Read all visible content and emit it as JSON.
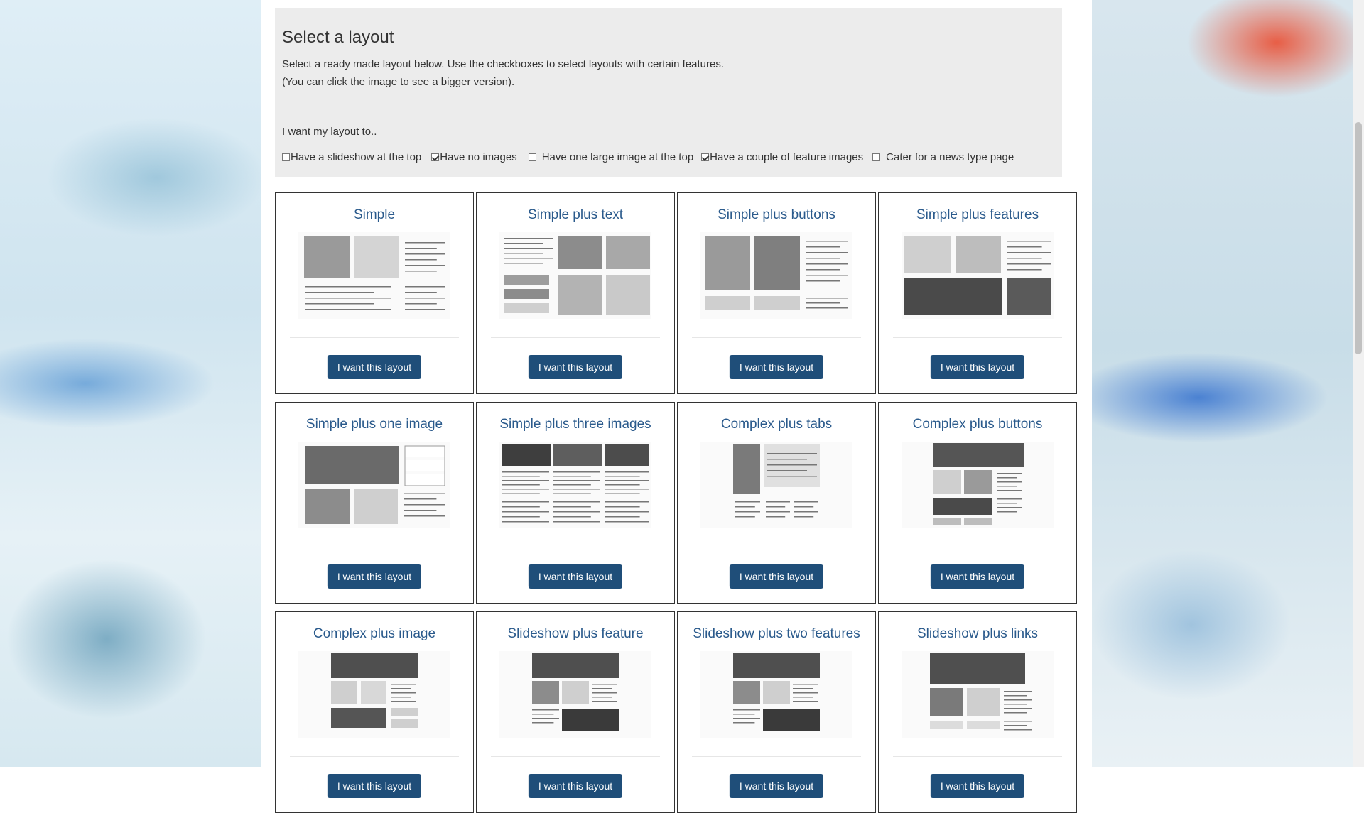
{
  "intro": {
    "title": "Select a layout",
    "line1": "Select a ready made layout below. Use the checkboxes to select layouts with certain features.",
    "line2": "(You can click the image to see a bigger version).",
    "prompt": "I want my layout to.."
  },
  "filters": [
    {
      "label": "Have a slideshow at the top",
      "checked": false
    },
    {
      "label": "Have no images",
      "checked": true
    },
    {
      "label": "Have one large image at the top",
      "checked": false
    },
    {
      "label": "Have a couple of feature images",
      "checked": true
    },
    {
      "label": "Cater for a news type page",
      "checked": false
    }
  ],
  "layouts": [
    {
      "title": "Simple",
      "button": "I want this layout",
      "thumb": "text"
    },
    {
      "title": "Simple plus text",
      "button": "I want this layout",
      "thumb": "text-buttons"
    },
    {
      "title": "Simple plus buttons",
      "button": "I want this layout",
      "thumb": "buttons"
    },
    {
      "title": "Simple plus features",
      "button": "I want this layout",
      "thumb": "features"
    },
    {
      "title": "Simple plus one image",
      "button": "I want this layout",
      "thumb": "one-image"
    },
    {
      "title": "Simple plus three images",
      "button": "I want this layout",
      "thumb": "three-images"
    },
    {
      "title": "Complex plus tabs",
      "button": "I want this layout",
      "thumb": "tabs"
    },
    {
      "title": "Complex plus buttons",
      "button": "I want this layout",
      "thumb": "complex"
    },
    {
      "title": "Complex plus image",
      "button": "I want this layout",
      "thumb": "complex-image"
    },
    {
      "title": "Slideshow plus feature",
      "button": "I want this layout",
      "thumb": "slideshow"
    },
    {
      "title": "Slideshow plus two features",
      "button": "I want this layout",
      "thumb": "slideshow"
    },
    {
      "title": "Slideshow plus links",
      "button": "I want this layout",
      "thumb": "slideshow-links"
    }
  ],
  "colors": {
    "accent": "#1f4e79",
    "title": "#2a5a8c",
    "panel": "#ececec"
  }
}
